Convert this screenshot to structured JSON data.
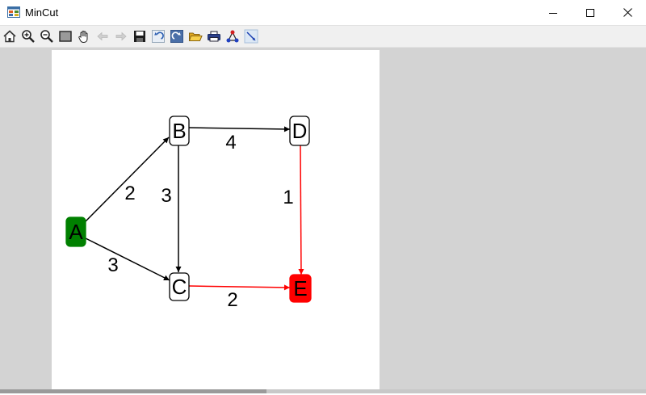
{
  "window": {
    "title": "MinCut"
  },
  "toolbar": {
    "buttons": [
      {
        "name": "home-icon"
      },
      {
        "name": "zoom-in-icon"
      },
      {
        "name": "zoom-out-icon"
      },
      {
        "name": "fit-window-icon"
      },
      {
        "name": "pan-hand-icon"
      },
      {
        "name": "back-arrow-icon"
      },
      {
        "name": "forward-arrow-icon"
      },
      {
        "name": "save-icon"
      },
      {
        "name": "undo-icon"
      },
      {
        "name": "redo-icon"
      },
      {
        "name": "open-folder-icon"
      },
      {
        "name": "print-icon"
      },
      {
        "name": "layout-graph-icon"
      },
      {
        "name": "edge-tool-icon"
      }
    ]
  },
  "graph": {
    "nodes": [
      {
        "id": "A",
        "label": "A",
        "fill": "#008000",
        "role": "source"
      },
      {
        "id": "B",
        "label": "B",
        "fill": "#ffffff"
      },
      {
        "id": "C",
        "label": "C",
        "fill": "#ffffff"
      },
      {
        "id": "D",
        "label": "D",
        "fill": "#ffffff"
      },
      {
        "id": "E",
        "label": "E",
        "fill": "#ff0000",
        "role": "sink"
      }
    ],
    "edges": [
      {
        "from": "A",
        "to": "B",
        "weight": "2",
        "color": "#000000"
      },
      {
        "from": "A",
        "to": "C",
        "weight": "3",
        "color": "#000000"
      },
      {
        "from": "B",
        "to": "C",
        "weight": "3",
        "color": "#000000"
      },
      {
        "from": "B",
        "to": "D",
        "weight": "4",
        "color": "#000000"
      },
      {
        "from": "D",
        "to": "E",
        "weight": "1",
        "color": "#ff0000"
      },
      {
        "from": "C",
        "to": "E",
        "weight": "2",
        "color": "#ff0000"
      }
    ]
  }
}
